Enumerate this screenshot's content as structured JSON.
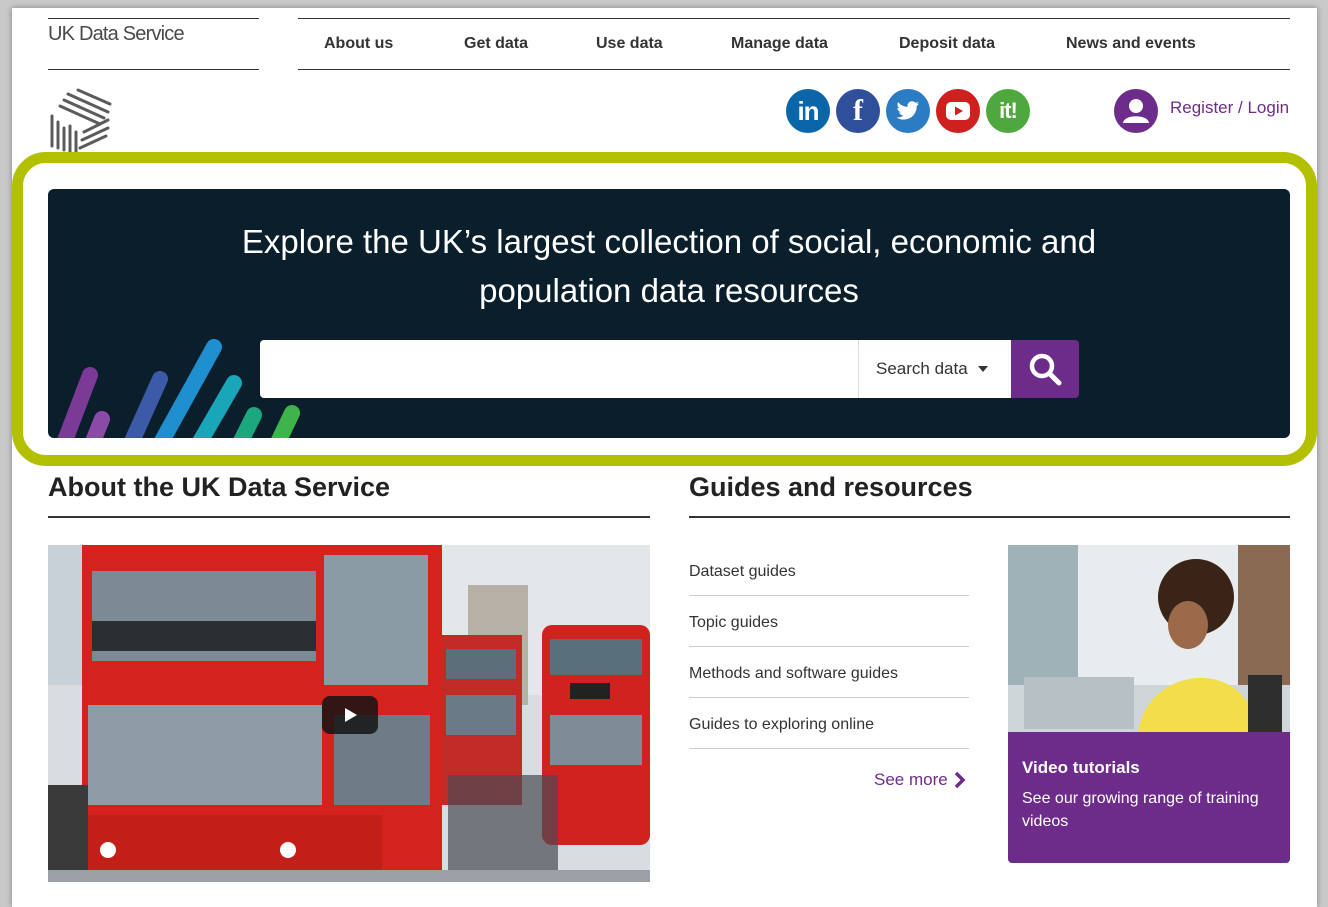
{
  "brand": {
    "name": "UK Data Service"
  },
  "nav": {
    "items": [
      {
        "label": "About us"
      },
      {
        "label": "Get data"
      },
      {
        "label": "Use data"
      },
      {
        "label": "Manage data"
      },
      {
        "label": "Deposit data"
      },
      {
        "label": "News and events"
      }
    ]
  },
  "social": [
    {
      "icon": "linkedin-icon",
      "glyph": "in",
      "color": "#0a66a8"
    },
    {
      "icon": "facebook-icon",
      "glyph": "f",
      "color": "#2f4f9a"
    },
    {
      "icon": "twitter-icon",
      "glyph": "",
      "color": "#2c7cc4"
    },
    {
      "icon": "youtube-icon",
      "glyph": "",
      "color": "#d01f1f"
    },
    {
      "icon": "it-icon",
      "glyph": "it!",
      "color": "#4fa83d"
    }
  ],
  "account": {
    "register_login": "Register / Login"
  },
  "hero": {
    "title_line1": "Explore the UK’s largest collection of social, economic and",
    "title_line2": "population data resources",
    "search_placeholder": "",
    "search_scope": "Search data",
    "accent": "#b3c000",
    "bg": "#0a1f2b"
  },
  "about": {
    "title": "About the UK Data Service"
  },
  "guides": {
    "title": "Guides and resources",
    "items": [
      {
        "label": "Dataset guides"
      },
      {
        "label": "Topic guides"
      },
      {
        "label": "Methods and software guides"
      },
      {
        "label": "Guides to exploring online"
      }
    ],
    "see_more": "See more"
  },
  "video": {
    "title": "Video tutorials",
    "text": "See our growing range of training videos"
  },
  "colors": {
    "brand_purple": "#6d2c8a",
    "outline_green": "#b3c000"
  }
}
